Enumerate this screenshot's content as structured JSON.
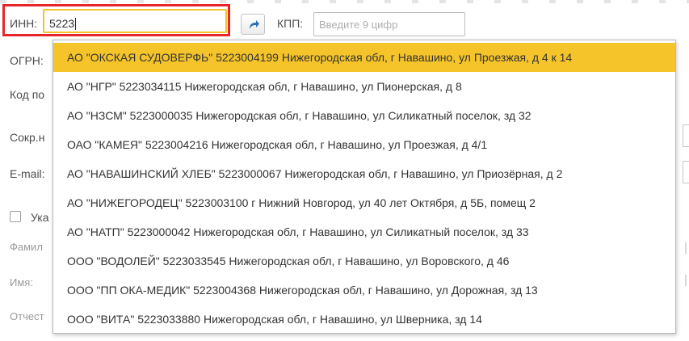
{
  "form": {
    "inn_label": "ИНН:",
    "inn_value": "5223",
    "kpp_label": "КПП:",
    "kpp_placeholder": "Введите 9 цифр",
    "ogrn_label": "ОГРН:",
    "code_label": "Код по",
    "short_name_label": "Сокр.н",
    "email_label": "E-mail:",
    "checkbox_label": "Ука",
    "lastname_label": "Фамил",
    "firstname_label": "Имя:",
    "patronymic_label": "Отчест"
  },
  "suggestions": {
    "selected_index": 0,
    "highlight_color": "#f5c42b",
    "items": [
      "АО \"ОКСКАЯ СУДОВЕРФЬ\" 5223004199 Нижегородская обл, г Навашино, ул Проезжая, д 4 к 14",
      "АО \"НГР\" 5223034115 Нижегородская обл, г Навашино, ул Пионерская, д 8",
      "АО \"НЗСМ\" 5223000035 Нижегородская обл, г Навашино, ул Силикатный поселок, зд 32",
      "ОАО \"КАМЕЯ\" 5223004216 Нижегородская обл, г Навашино, ул Проезжая, д 4/1",
      "АО \"НАВАШИНСКИЙ ХЛЕБ\" 5223000067 Нижегородская обл, г Навашино, ул Приозёрная, д 2",
      "АО \"НИЖЕГОРОДЕЦ\" 5223003100 г Нижний Новгород, ул 40 лет Октября, д 5Б, помещ 2",
      "АО \"НАТП\" 5223000042 Нижегородская обл, г Навашино, ул Силикатный поселок, зд 33",
      "ООО \"ВОДОЛЕЙ\" 5223033545 Нижегородская обл, г Навашино, ул Воровского, д 46",
      "ООО \"ПП ОКА-МЕДИК\" 5223004368 Нижегородская обл, г Навашино, ул Дорожная, зд 13",
      "ООО \"ВИТА\" 5223033880 Нижегородская обл, г Навашино, ул Шверника, зд 14"
    ]
  },
  "icons": {
    "search_button": "arrow-redo-icon"
  },
  "colors": {
    "inn_input_border": "#f2c230",
    "annotation_box": "#e8262a",
    "button_arrow": "#2a6fb5"
  }
}
